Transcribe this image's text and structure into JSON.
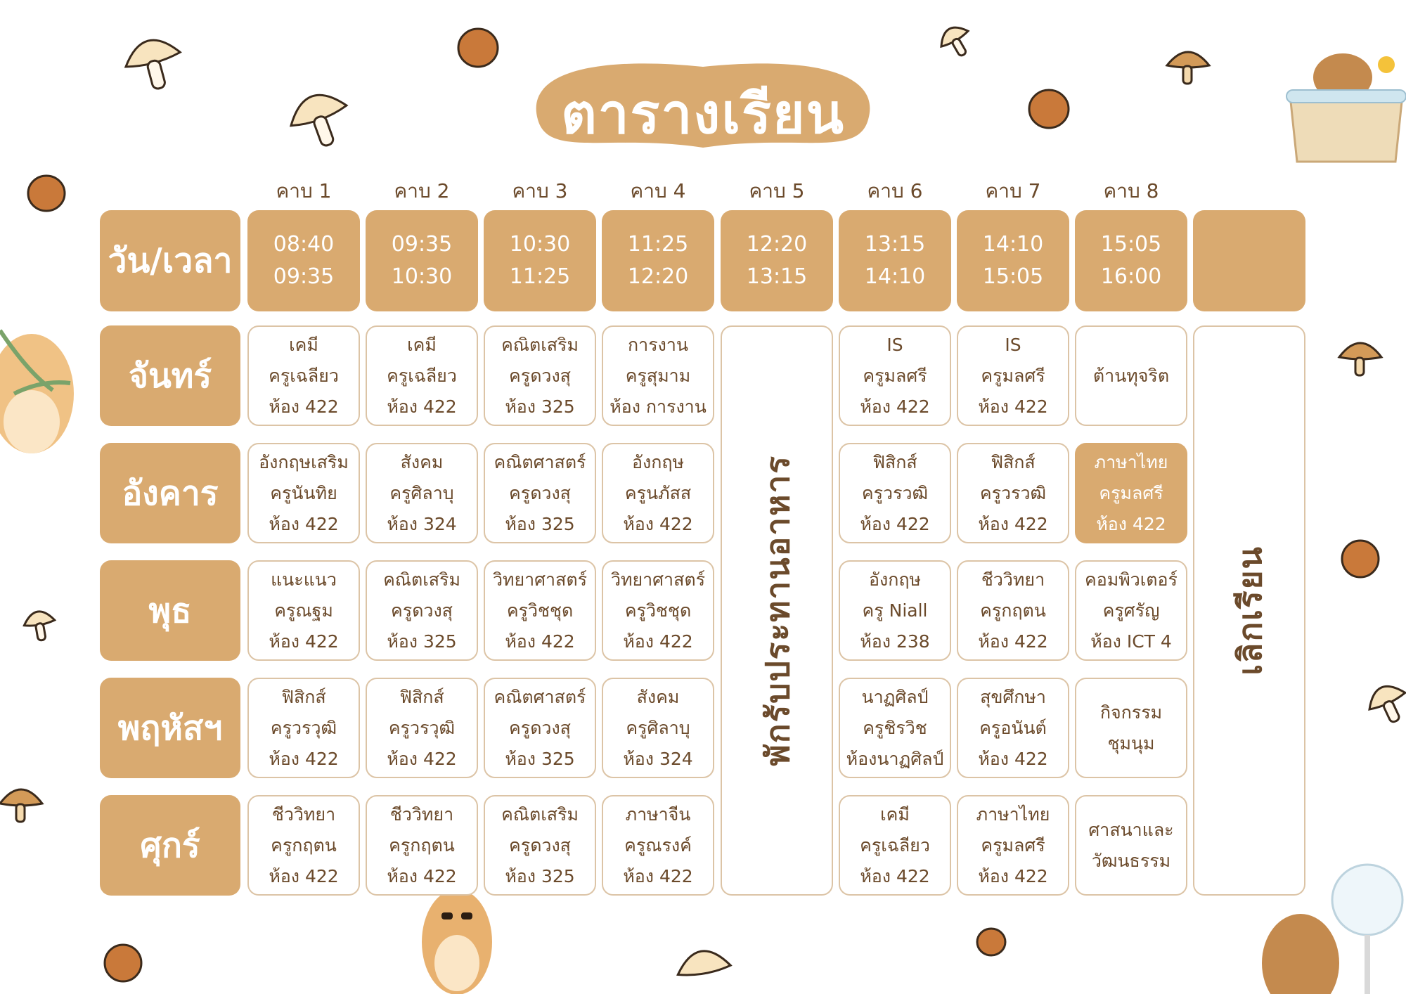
{
  "title": "ตารางเรียน",
  "corner_label": "วัน/เวลา",
  "periods": [
    {
      "label": "คาบ 1",
      "start": "08:40",
      "end": "09:35"
    },
    {
      "label": "คาบ 2",
      "start": "09:35",
      "end": "10:30"
    },
    {
      "label": "คาบ 3",
      "start": "10:30",
      "end": "11:25"
    },
    {
      "label": "คาบ 4",
      "start": "11:25",
      "end": "12:20"
    },
    {
      "label": "คาบ 5",
      "start": "12:20",
      "end": "13:15"
    },
    {
      "label": "คาบ 6",
      "start": "13:15",
      "end": "14:10"
    },
    {
      "label": "คาบ 7",
      "start": "14:10",
      "end": "15:05"
    },
    {
      "label": "คาบ 8",
      "start": "15:05",
      "end": "16:00"
    }
  ],
  "lunch_label": "พักรับประทานอาหาร",
  "dismiss_label": "เลิกเรียน",
  "days": [
    {
      "name": "จันทร์",
      "slots": [
        [
          "เคมี",
          "ครูเฉลียว",
          "ห้อง 422"
        ],
        [
          "เคมี",
          "ครูเฉลียว",
          "ห้อง 422"
        ],
        [
          "คณิตเสริม",
          "ครูดวงสุ",
          "ห้อง 325"
        ],
        [
          "การงาน",
          "ครูสุมาม",
          "ห้อง การงาน"
        ],
        [
          "IS",
          "ครูมลศรี",
          "ห้อง 422"
        ],
        [
          "IS",
          "ครูมลศรี",
          "ห้อง 422"
        ],
        [
          "ต้านทุจริต"
        ]
      ]
    },
    {
      "name": "อังคาร",
      "slots": [
        [
          "อังกฤษเสริม",
          "ครูนันทิย",
          "ห้อง 422"
        ],
        [
          "สังคม",
          "ครูศิลาบุ",
          "ห้อง 324"
        ],
        [
          "คณิตศาสตร์",
          "ครูดวงสุ",
          "ห้อง 325"
        ],
        [
          "อังกฤษ",
          "ครูนภัสส",
          "ห้อง 422"
        ],
        [
          "ฟิสิกส์",
          "ครูวรวฒิ",
          "ห้อง 422"
        ],
        [
          "ฟิสิกส์",
          "ครูวรวฒิ",
          "ห้อง 422"
        ],
        [
          "ภาษาไทย",
          "ครูมลศรี",
          "ห้อง 422"
        ]
      ]
    },
    {
      "name": "พุธ",
      "slots": [
        [
          "แนะแนว",
          "ครูณฐม",
          "ห้อง 422"
        ],
        [
          "คณิตเสริม",
          "ครูดวงสุ",
          "ห้อง 325"
        ],
        [
          "วิทยาศาสตร์",
          "ครูวิชชุด",
          "ห้อง 422"
        ],
        [
          "วิทยาศาสตร์",
          "ครูวิชชุด",
          "ห้อง 422"
        ],
        [
          "อังกฤษ",
          "ครู Niall",
          "ห้อง 238"
        ],
        [
          "ชีววิทยา",
          "ครูกฤตน",
          "ห้อง 422"
        ],
        [
          "คอมพิวเตอร์",
          "ครูศรัญ",
          "ห้อง ICT 4"
        ]
      ]
    },
    {
      "name": "พฤหัสฯ",
      "slots": [
        [
          "ฟิสิกส์",
          "ครูวรวุฒิ",
          "ห้อง 422"
        ],
        [
          "ฟิสิกส์",
          "ครูวรวุฒิ",
          "ห้อง 422"
        ],
        [
          "คณิตศาสตร์",
          "ครูดวงสุ",
          "ห้อง 325"
        ],
        [
          "สังคม",
          "ครูศิลาบุ",
          "ห้อง 324"
        ],
        [
          "นาฏศิลป์",
          "ครูชิรวิช",
          "ห้องนาฏศิลป์"
        ],
        [
          "สุขศึกษา",
          "ครูอนันต์",
          "ห้อง 422"
        ],
        [
          "กิจกรรม",
          "ชุมนุม"
        ]
      ]
    },
    {
      "name": "ศุกร์",
      "slots": [
        [
          "ชีววิทยา",
          "ครูกฤตน",
          "ห้อง 422"
        ],
        [
          "ชีววิทยา",
          "ครูกฤตน",
          "ห้อง 422"
        ],
        [
          "คณิตเสริม",
          "ครูดวงสุ",
          "ห้อง 325"
        ],
        [
          "ภาษาจีน",
          "ครูณรงค์",
          "ห้อง 422"
        ],
        [
          "เคมี",
          "ครูเฉลียว",
          "ห้อง 422"
        ],
        [
          "ภาษาไทย",
          "ครูมลศรี",
          "ห้อง 422"
        ],
        [
          "ศาสนาและ",
          "วัฒนธรรม"
        ]
      ]
    }
  ],
  "highlight": {
    "day": 1,
    "slot": 6
  },
  "colors": {
    "accent": "#d9aa70",
    "text": "#6b4a2b",
    "border": "#dcc4a6"
  }
}
